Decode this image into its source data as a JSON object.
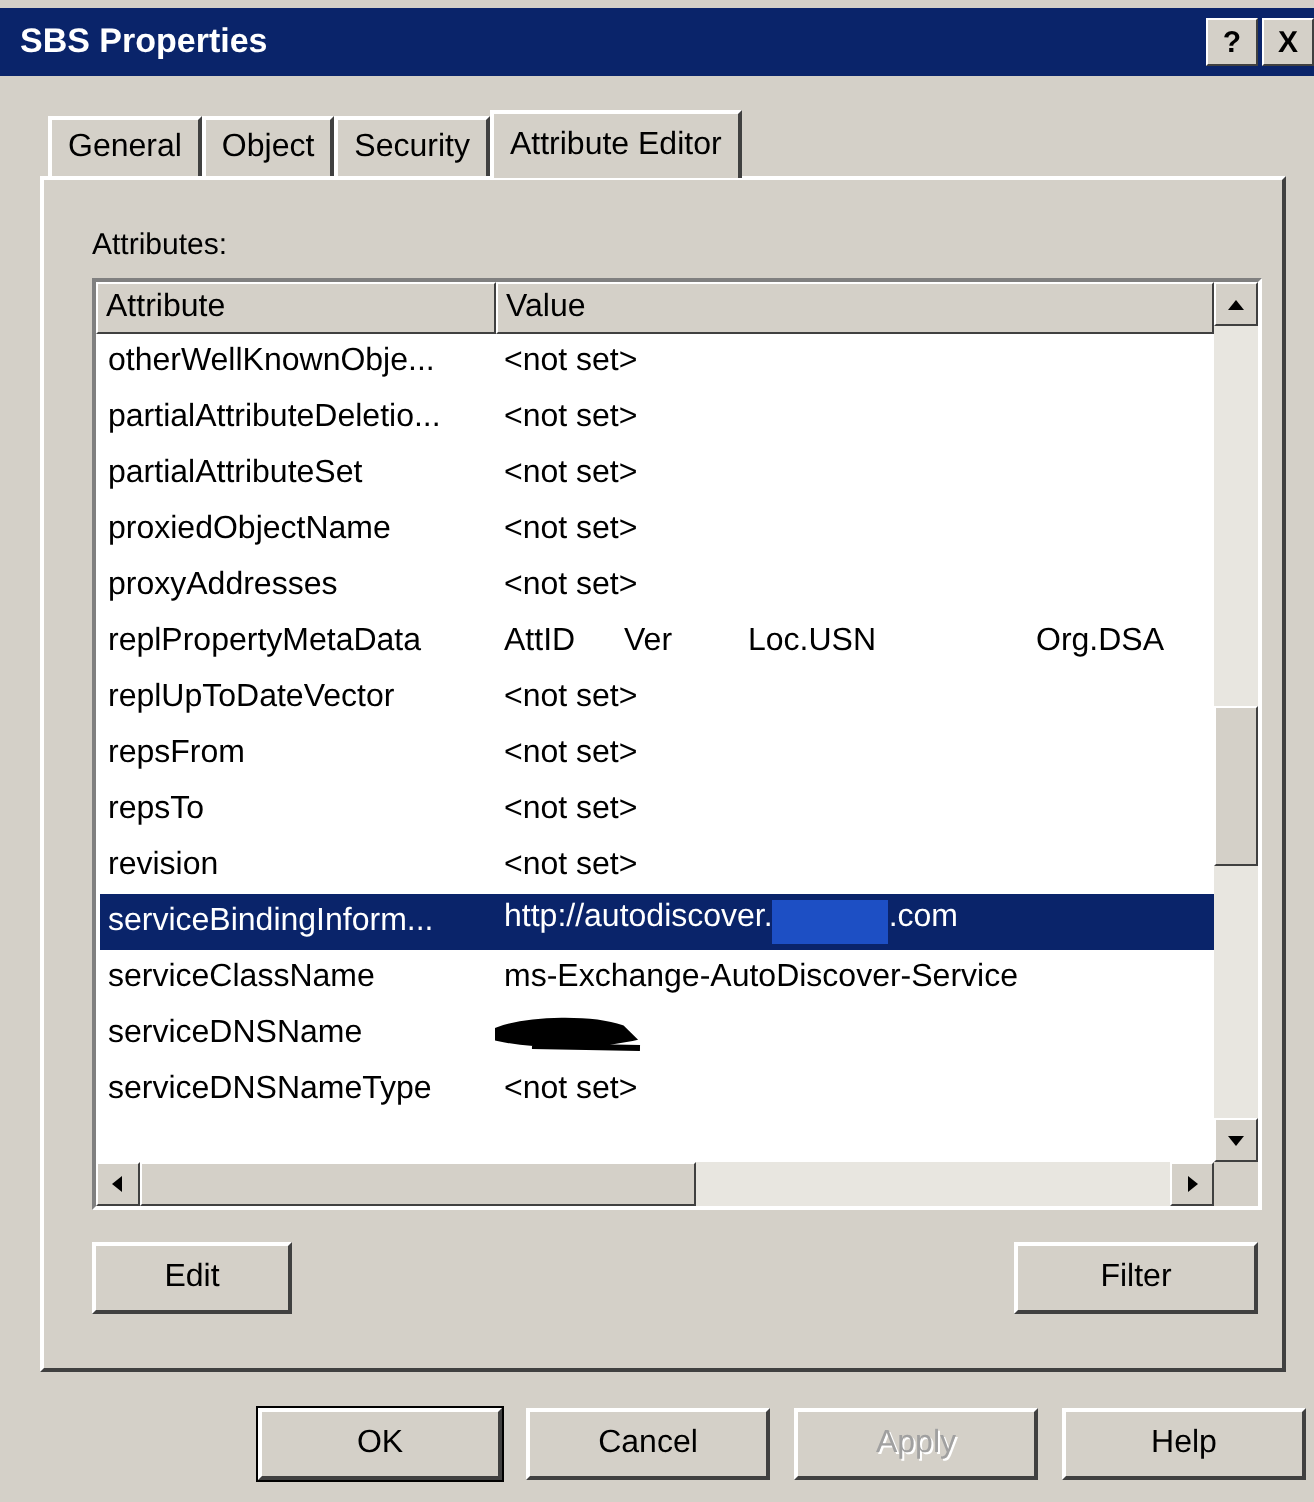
{
  "window": {
    "title": "SBS Properties",
    "help_button": "?",
    "close_button": "X"
  },
  "tabs": [
    {
      "label": "General",
      "selected": false
    },
    {
      "label": "Object",
      "selected": false
    },
    {
      "label": "Security",
      "selected": false
    },
    {
      "label": "Attribute Editor",
      "selected": true
    }
  ],
  "attributes_label": "Attributes:",
  "table": {
    "columns": [
      "Attribute",
      "Value"
    ],
    "rows": [
      {
        "attribute": "otherWellKnownObje...",
        "kind": "text",
        "value": "<not set>",
        "selected": false
      },
      {
        "attribute": "partialAttributeDeletio...",
        "kind": "text",
        "value": "<not set>",
        "selected": false
      },
      {
        "attribute": "partialAttributeSet",
        "kind": "text",
        "value": "<not set>",
        "selected": false
      },
      {
        "attribute": "proxiedObjectName",
        "kind": "text",
        "value": "<not set>",
        "selected": false
      },
      {
        "attribute": "proxyAddresses",
        "kind": "text",
        "value": "<not set>",
        "selected": false
      },
      {
        "attribute": "replPropertyMetaData",
        "kind": "columns",
        "values": [
          "AttID",
          "Ver",
          "Loc.USN",
          "Org.DSA"
        ],
        "selected": false
      },
      {
        "attribute": "replUpToDateVector",
        "kind": "text",
        "value": "<not set>",
        "selected": false
      },
      {
        "attribute": "repsFrom",
        "kind": "text",
        "value": "<not set>",
        "selected": false
      },
      {
        "attribute": "repsTo",
        "kind": "text",
        "value": "<not set>",
        "selected": false
      },
      {
        "attribute": "revision",
        "kind": "text",
        "value": "<not set>",
        "selected": false
      },
      {
        "attribute": "serviceBindingInform...",
        "kind": "masked",
        "value": "http://autodiscover.",
        "value_suffix": ".com",
        "selected": true
      },
      {
        "attribute": "serviceClassName",
        "kind": "text",
        "value": "ms-Exchange-AutoDiscover-Service",
        "selected": false
      },
      {
        "attribute": "serviceDNSName",
        "kind": "scribbled",
        "selected": false
      },
      {
        "attribute": "serviceDNSNameType",
        "kind": "text",
        "value": "<not set>",
        "selected": false
      }
    ]
  },
  "panel_buttons": [
    {
      "label": "Edit"
    },
    {
      "label": "Filter"
    }
  ],
  "dialog_buttons": [
    {
      "label": "OK",
      "default": true,
      "disabled": false
    },
    {
      "label": "Cancel",
      "default": false,
      "disabled": false
    },
    {
      "label": "Apply",
      "default": false,
      "disabled": true
    },
    {
      "label": "Help",
      "default": false,
      "disabled": false
    }
  ]
}
